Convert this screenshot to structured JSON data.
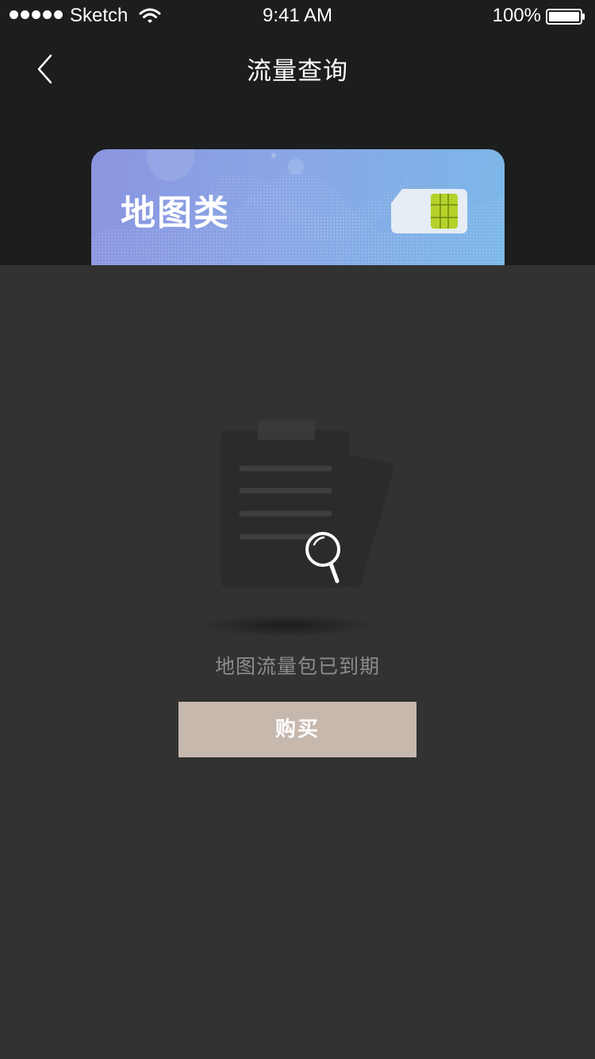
{
  "status_bar": {
    "carrier": "Sketch",
    "time": "9:41 AM",
    "battery": "100%"
  },
  "nav": {
    "title": "流量查询",
    "back_icon": "chevron-left-icon"
  },
  "card": {
    "title": "地图类",
    "chip_icon": "sim-card-icon"
  },
  "empty_state": {
    "icon": "clipboard-search-icon",
    "message": "地图流量包已到期"
  },
  "actions": {
    "buy_label": "购买"
  },
  "colors": {
    "header_bg": "#1c1d1d",
    "page_bg": "#313231",
    "button_bg": "#c7b8ae",
    "card_gradient_start": "#8b95e0",
    "card_gradient_end": "#7cb8e8",
    "chip": "#b6d22a"
  }
}
